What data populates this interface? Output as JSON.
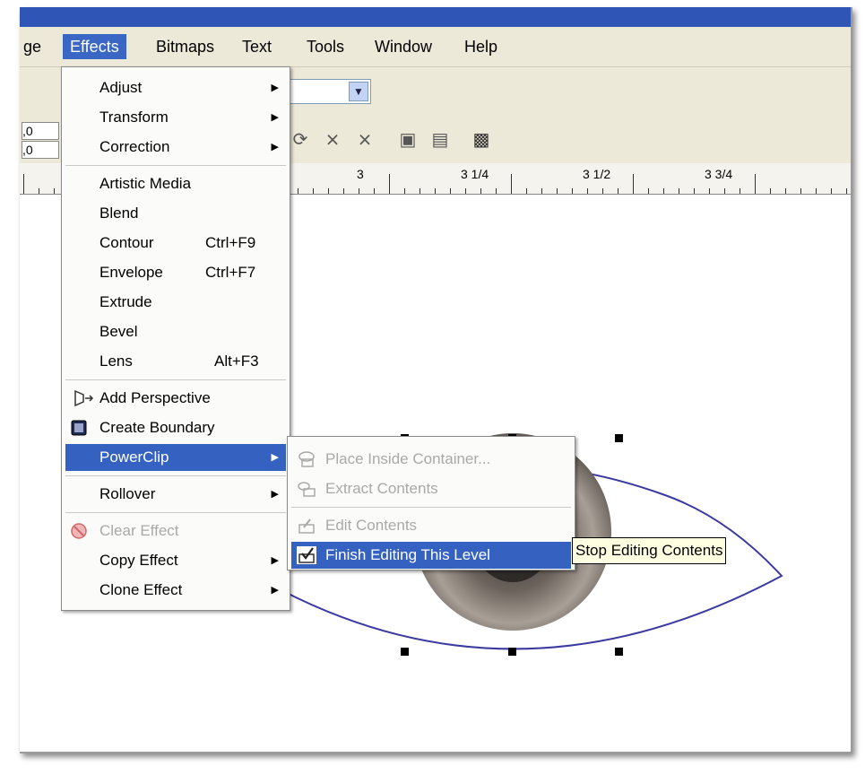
{
  "menubar": {
    "items": [
      {
        "label": "ge"
      },
      {
        "label": "Effects"
      },
      {
        "label": "Bitmaps"
      },
      {
        "label": "Text"
      },
      {
        "label": "Tools"
      },
      {
        "label": "Window"
      },
      {
        "label": "Help"
      }
    ]
  },
  "toolbar": {
    "field1": ",0",
    "field2": ",0",
    "icons": [
      "rotate-icon",
      "trim-icon",
      "intersect-icon",
      "group-icon",
      "ungroup-icon",
      "to-front-icon"
    ]
  },
  "ruler": {
    "labels": [
      "3",
      "3 1/4",
      "3 1/2",
      "3 3/4"
    ]
  },
  "effects_menu": {
    "items": [
      {
        "label": "Adjust",
        "submenu": true
      },
      {
        "label": "Transform",
        "submenu": true
      },
      {
        "label": "Correction",
        "submenu": true
      },
      {
        "label": "Artistic Media"
      },
      {
        "label": "Blend"
      },
      {
        "label": "Contour",
        "shortcut": "Ctrl+F9"
      },
      {
        "label": "Envelope",
        "shortcut": "Ctrl+F7"
      },
      {
        "label": "Extrude"
      },
      {
        "label": "Bevel"
      },
      {
        "label": "Lens",
        "shortcut": "Alt+F3"
      },
      {
        "label": "Add Perspective"
      },
      {
        "label": "Create Boundary"
      },
      {
        "label": "PowerClip",
        "submenu": true,
        "highlighted": true
      },
      {
        "label": "Rollover",
        "submenu": true
      },
      {
        "label": "Clear Effect",
        "disabled": true
      },
      {
        "label": "Copy Effect",
        "submenu": true
      },
      {
        "label": "Clone Effect",
        "submenu": true
      }
    ]
  },
  "powerclip_submenu": {
    "items": [
      {
        "label": "Place Inside Container...",
        "disabled": true
      },
      {
        "label": "Extract Contents",
        "disabled": true
      },
      {
        "label": "Edit Contents",
        "disabled": true
      },
      {
        "label": "Finish Editing This Level",
        "highlighted": true
      }
    ]
  },
  "tooltip": {
    "text": "Stop Editing Contents"
  },
  "colors": {
    "accent": "#3561c1",
    "titlebar": "#2f56b7",
    "chrome": "#ece9d8"
  }
}
